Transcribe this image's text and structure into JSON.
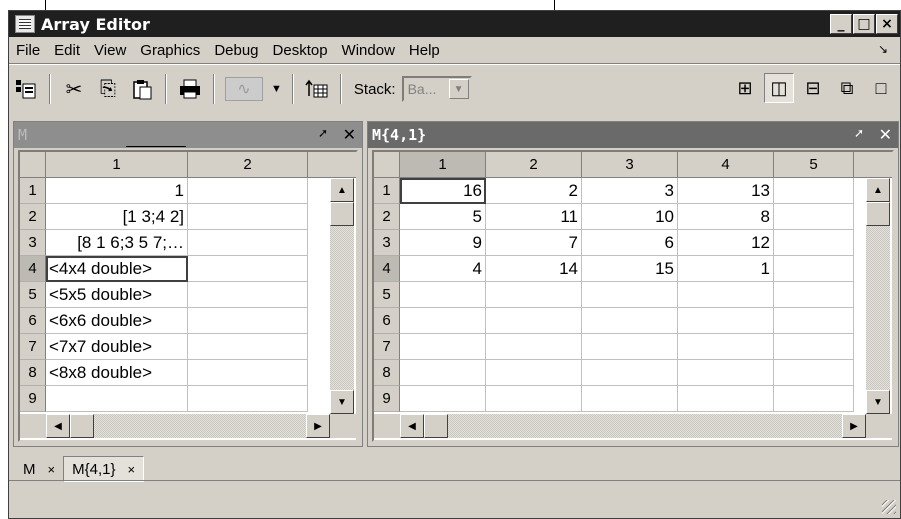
{
  "window": {
    "title": "Array Editor",
    "min": "_",
    "max": "□",
    "close": "×"
  },
  "menu": [
    "File",
    "Edit",
    "View",
    "Graphics",
    "Debug",
    "Desktop",
    "Window",
    "Help"
  ],
  "menu_undock": "↘",
  "toolbar": {
    "import_icon": "import-data-icon",
    "cut": "✂",
    "copy": "⎘",
    "paste": "📋",
    "print": "🖶",
    "plot": "∿",
    "plot_drop": "▼",
    "transpose": "↕▦",
    "stack_label": "Stack:",
    "stack_value": "Ba...",
    "stack_arrow": "▼"
  },
  "layouts": [
    "⊞",
    "◫",
    "⊟",
    "⧉",
    "□"
  ],
  "left_panel": {
    "title": "M",
    "undock": "➚",
    "close": "✕",
    "columns": [
      "1",
      "2"
    ],
    "rows": [
      "1",
      "2",
      "3",
      "4",
      "5",
      "6",
      "7",
      "8",
      "9"
    ],
    "values": [
      "1",
      "[1 3;4 2]",
      "[8 1 6;3 5 7;…",
      "<4x4 double>",
      "<5x5 double>",
      "<6x6 double>",
      "<7x7 double>",
      "<8x8 double>",
      ""
    ]
  },
  "right_panel": {
    "title": "M{4,1}",
    "undock": "➚",
    "close": "✕",
    "columns": [
      "1",
      "2",
      "3",
      "4",
      "5"
    ],
    "rows": [
      "1",
      "2",
      "3",
      "4",
      "5",
      "6",
      "7",
      "8",
      "9"
    ],
    "values": [
      [
        "16",
        "2",
        "3",
        "13",
        ""
      ],
      [
        "5",
        "11",
        "10",
        "8",
        ""
      ],
      [
        "9",
        "7",
        "6",
        "12",
        ""
      ],
      [
        "4",
        "14",
        "15",
        "1",
        ""
      ]
    ]
  },
  "scroll": {
    "up": "▲",
    "down": "▼",
    "left": "◀",
    "right": "▶"
  },
  "tabs": [
    {
      "label": "M",
      "close": "×"
    },
    {
      "label": "M{4,1}",
      "close": "×"
    }
  ]
}
